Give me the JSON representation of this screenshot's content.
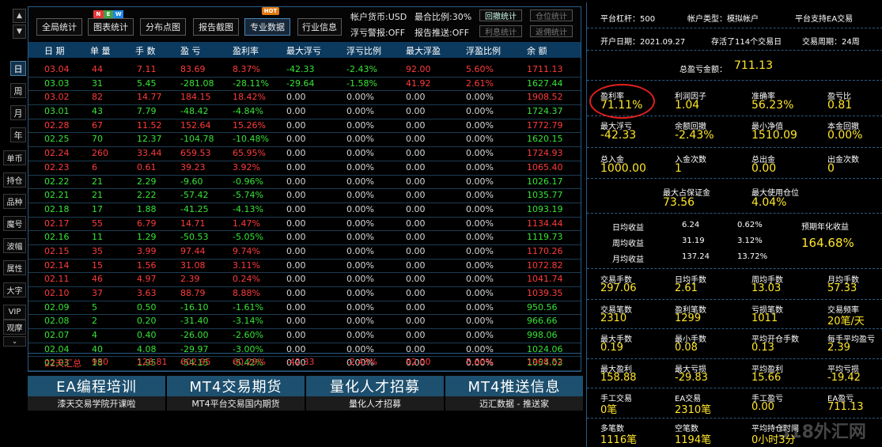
{
  "nav": {
    "up": "▲",
    "down": "▼",
    "periods": [
      "日",
      "周",
      "月",
      "年"
    ],
    "side": [
      "单币",
      "持仓",
      "品种",
      "魔号",
      "波幅",
      "属性",
      "大字",
      "VIP",
      "观摩"
    ],
    "collapse": "⌄"
  },
  "toolbar": {
    "buttons": [
      "全局统计",
      "图表统计",
      "分布点图",
      "报告截图",
      "专业数据",
      "行业信息"
    ],
    "new_badge": [
      "N",
      "E",
      "W"
    ],
    "hot_badge": "HOT",
    "currency": "帐户货币:USD",
    "max_ratio": "最合比例:30%",
    "float_alert": "浮亏警报:OFF",
    "report_push": "报告推送:OFF",
    "stat_buttons": [
      "回撤统计",
      "仓位统计",
      "利息统计",
      "返佣统计"
    ]
  },
  "table": {
    "headers": [
      "日 期",
      "单 量",
      "手 数",
      "盈 亏",
      "盈利率",
      "最大浮亏",
      "浮亏比例",
      "最大浮盈",
      "浮盈比例",
      "余 额"
    ],
    "rows": [
      {
        "c": [
          "03.04",
          "44",
          "7.11",
          "83.69",
          "8.37%",
          "-42.33",
          "-2.43%",
          "92.00",
          "5.60%",
          "1711.13"
        ],
        "color": "red"
      },
      {
        "c": [
          "03.03",
          "31",
          "5.45",
          "-281.08",
          "-28.11%",
          "-29.64",
          "-1.58%",
          "41.92",
          "2.61%",
          "1627.44"
        ],
        "color": "green"
      },
      {
        "c": [
          "03.02",
          "82",
          "14.77",
          "184.15",
          "18.42%",
          "0.00",
          "0.00%",
          "0.00",
          "0.00%",
          "1908.52"
        ],
        "color": "red"
      },
      {
        "c": [
          "03.01",
          "43",
          "7.79",
          "-48.42",
          "-4.84%",
          "0.00",
          "0.00%",
          "0.00",
          "0.00%",
          "1724.37"
        ],
        "color": "green"
      },
      {
        "c": [
          "02.28",
          "67",
          "11.52",
          "152.64",
          "15.26%",
          "0.00",
          "0.00%",
          "0.00",
          "0.00%",
          "1772.79"
        ],
        "color": "red"
      },
      {
        "c": [
          "02.25",
          "70",
          "12.37",
          "-104.78",
          "-10.48%",
          "0.00",
          "0.00%",
          "0.00",
          "0.00%",
          "1620.15"
        ],
        "color": "green"
      },
      {
        "c": [
          "02.24",
          "260",
          "33.44",
          "659.53",
          "65.95%",
          "0.00",
          "0.00%",
          "0.00",
          "0.00%",
          "1724.93"
        ],
        "color": "red"
      },
      {
        "c": [
          "02.23",
          "6",
          "0.61",
          "39.23",
          "3.92%",
          "0.00",
          "0.00%",
          "0.00",
          "0.00%",
          "1065.40"
        ],
        "color": "red"
      },
      {
        "c": [
          "02.22",
          "21",
          "2.29",
          "-9.60",
          "-0.96%",
          "0.00",
          "0.00%",
          "0.00",
          "0.00%",
          "1026.17"
        ],
        "color": "green"
      },
      {
        "c": [
          "02.21",
          "21",
          "2.22",
          "-57.42",
          "-5.74%",
          "0.00",
          "0.00%",
          "0.00",
          "0.00%",
          "1035.77"
        ],
        "color": "green"
      },
      {
        "c": [
          "02.18",
          "17",
          "1.88",
          "-41.25",
          "-4.13%",
          "0.00",
          "0.00%",
          "0.00",
          "0.00%",
          "1093.19"
        ],
        "color": "green"
      },
      {
        "c": [
          "02.17",
          "55",
          "6.79",
          "14.71",
          "1.47%",
          "0.00",
          "0.00%",
          "0.00",
          "0.00%",
          "1134.44"
        ],
        "color": "red"
      },
      {
        "c": [
          "02.16",
          "11",
          "1.29",
          "-50.53",
          "-5.05%",
          "0.00",
          "0.00%",
          "0.00",
          "0.00%",
          "1119.73"
        ],
        "color": "green"
      },
      {
        "c": [
          "02.15",
          "35",
          "3.99",
          "97.44",
          "9.74%",
          "0.00",
          "0.00%",
          "0.00",
          "0.00%",
          "1170.26"
        ],
        "color": "red"
      },
      {
        "c": [
          "02.14",
          "15",
          "1.56",
          "31.08",
          "3.11%",
          "0.00",
          "0.00%",
          "0.00",
          "0.00%",
          "1072.82"
        ],
        "color": "red"
      },
      {
        "c": [
          "02.11",
          "46",
          "4.97",
          "2.39",
          "0.24%",
          "0.00",
          "0.00%",
          "0.00",
          "0.00%",
          "1041.74"
        ],
        "color": "red"
      },
      {
        "c": [
          "02.10",
          "37",
          "3.63",
          "88.79",
          "8.88%",
          "0.00",
          "0.00%",
          "0.00",
          "0.00%",
          "1039.35"
        ],
        "color": "red"
      },
      {
        "c": [
          "02.09",
          "5",
          "0.50",
          "-16.10",
          "-1.61%",
          "0.00",
          "0.00%",
          "0.00",
          "0.00%",
          "950.56"
        ],
        "color": "green"
      },
      {
        "c": [
          "02.08",
          "2",
          "0.20",
          "-31.40",
          "-3.14%",
          "0.00",
          "0.00%",
          "0.00",
          "0.00%",
          "966.66"
        ],
        "color": "green"
      },
      {
        "c": [
          "02.07",
          "4",
          "0.40",
          "-26.00",
          "-2.60%",
          "0.00",
          "0.00%",
          "0.00",
          "0.00%",
          "998.06"
        ],
        "color": "green"
      },
      {
        "c": [
          "02.04",
          "40",
          "4.08",
          "-29.97",
          "-3.00%",
          "0.00",
          "0.00%",
          "0.00",
          "0.00%",
          "1024.06"
        ],
        "color": "green"
      },
      {
        "c": [
          "02.03",
          "18",
          "1.95",
          "-54.15",
          "-5.42%",
          "0.00",
          "0.00%",
          "0.00",
          "0.00%",
          "1054.03"
        ],
        "color": "green"
      }
    ],
    "summary": [
      "22天汇总",
      "930",
      "128.81",
      "602.95",
      "60.29%",
      "-42.33",
      "-2.43%",
      "92.00",
      "5.60%",
      "1908.52"
    ]
  },
  "banners": [
    {
      "title": "EA编程培训",
      "sub": "漆天交易学院开课啦"
    },
    {
      "title": "MT4交易期货",
      "sub": "MT4平台交易国内期货"
    },
    {
      "title": "量化人才招募",
      "sub": "量化人才招募"
    },
    {
      "title": "MT4推送信息",
      "sub": "迈汇数据 - 推送家"
    }
  ],
  "right": {
    "leverage": "平台杠杆：500",
    "account_type": "帐户类型：模拟帐户",
    "ea_support": "平台支持EA交易",
    "open_date": "开户日期：2021.09.27",
    "trading_days": "存活了114个交易日",
    "cycle": "交易周期：24周",
    "total_pl_label": "总盈亏金额：",
    "total_pl_value": "711.13",
    "grid1": [
      {
        "label": "盈利率",
        "value": "71.11%"
      },
      {
        "label": "利润因子",
        "value": "1.04"
      },
      {
        "label": "准确率",
        "value": "56.23%"
      },
      {
        "label": "盈亏比",
        "value": "0.81"
      },
      {
        "label": "最大浮亏",
        "value": "-42.33"
      },
      {
        "label": "余额回撤",
        "value": "-2.43%"
      },
      {
        "label": "最小净值",
        "value": "1510.09"
      },
      {
        "label": "本金回撤",
        "value": "0.00%"
      },
      {
        "label": "总入金",
        "value": "1000.00"
      },
      {
        "label": "入金次数",
        "value": "1"
      },
      {
        "label": "总出金",
        "value": "0.00"
      },
      {
        "label": "出金次数",
        "value": "0"
      }
    ],
    "margin": {
      "label": "最大占保证金",
      "value": "73.56"
    },
    "max_pos": {
      "label": "最大使用仓位",
      "value": "4.04%"
    },
    "avg": [
      {
        "label": "日均收益",
        "amount": "6.24",
        "pct": "0.62%"
      },
      {
        "label": "周均收益",
        "amount": "31.19",
        "pct": "3.12%"
      },
      {
        "label": "月均收益",
        "amount": "137.24",
        "pct": "13.72%"
      }
    ],
    "annual_label": "预期年化收益",
    "annual_value": "164.68%",
    "grid2": [
      {
        "label": "交易手数",
        "value": "297.06"
      },
      {
        "label": "日均手数",
        "value": "2.61"
      },
      {
        "label": "周均手数",
        "value": "13.03"
      },
      {
        "label": "月均手数",
        "value": "57.33"
      },
      {
        "label": "交易笔数",
        "value": "2310"
      },
      {
        "label": "盈利笔数",
        "value": "1299"
      },
      {
        "label": "亏损笔数",
        "value": "1011"
      },
      {
        "label": "交易频率",
        "value": "20笔/天"
      },
      {
        "label": "最大手数",
        "value": "0.19"
      },
      {
        "label": "最小手数",
        "value": "0.08"
      },
      {
        "label": "平均开仓手数",
        "value": "0.13"
      },
      {
        "label": "每手平均盈亏",
        "value": "2.39"
      },
      {
        "label": "最大盈利",
        "value": "158.88"
      },
      {
        "label": "最大亏损",
        "value": "-29.83"
      },
      {
        "label": "平均盈利",
        "value": "15.66"
      },
      {
        "label": "平均亏损",
        "value": "-19.42"
      },
      {
        "label": "手工交易",
        "value": "0笔"
      },
      {
        "label": "EA交易",
        "value": "2310笔"
      },
      {
        "label": "手工盈亏",
        "value": "0.00"
      },
      {
        "label": "EA盈亏",
        "value": "711.13"
      },
      {
        "label": "多笔数",
        "value": "1116笔"
      },
      {
        "label": "空笔数",
        "value": "1194笔"
      },
      {
        "label": "平均持仓时间",
        "value": "0小时3分"
      },
      {
        "label": "",
        "value": ""
      }
    ],
    "watermark": "518外汇网"
  },
  "colors": {
    "profit": "#ff3b3b",
    "loss": "#36e436",
    "value": "#ffe62a",
    "accent": "#2a5c86"
  }
}
